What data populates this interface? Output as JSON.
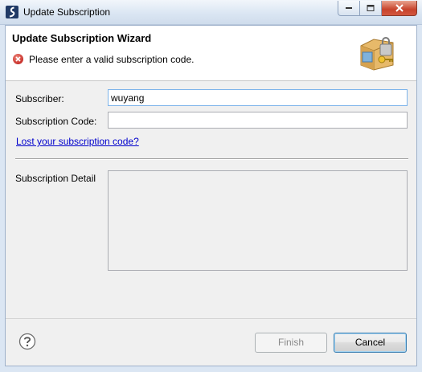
{
  "window": {
    "title": "Update Subscription"
  },
  "header": {
    "title": "Update Subscription Wizard",
    "message": "Please enter a valid subscription code."
  },
  "form": {
    "subscriber_label": "Subscriber:",
    "subscriber_value": "wuyang",
    "code_label": "Subscription Code:",
    "code_value": "",
    "lost_code_link": "Lost your subscription code?",
    "detail_label": "Subscription Detail"
  },
  "buttons": {
    "finish": "Finish",
    "cancel": "Cancel"
  },
  "icons": {
    "app": "app-icon",
    "error": "error-icon",
    "wizard": "subscription-key-icon",
    "help": "help-icon"
  }
}
